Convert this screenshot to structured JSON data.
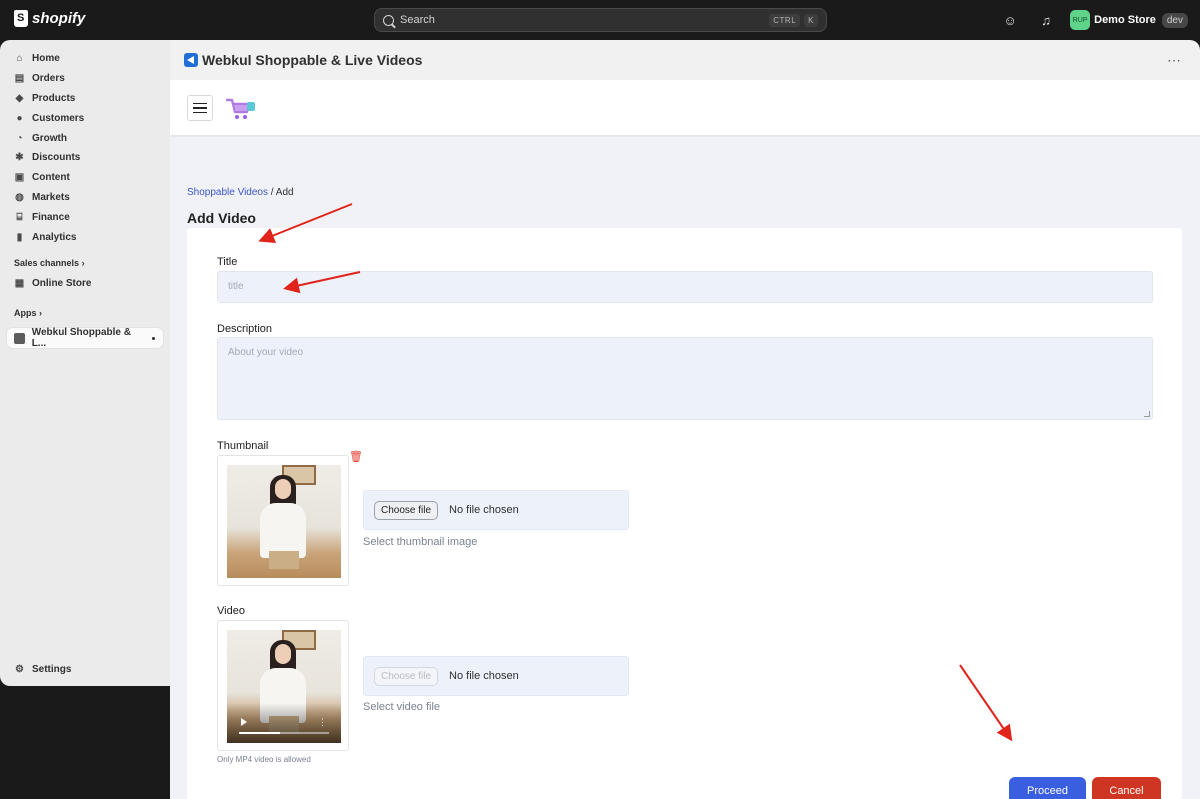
{
  "topbar": {
    "brand": "shopify",
    "search_label": "Search",
    "shortcut_keys": [
      "CTRL",
      "K"
    ],
    "store_avatar": "RUP",
    "store_name": "Demo Store",
    "store_badge": "dev"
  },
  "sidebar": {
    "items": [
      {
        "label": "Home",
        "icon": "home-icon",
        "glyph": "⌂"
      },
      {
        "label": "Orders",
        "icon": "inbox-icon",
        "glyph": "▤"
      },
      {
        "label": "Products",
        "icon": "tag-icon",
        "glyph": "◆"
      },
      {
        "label": "Customers",
        "icon": "person-icon",
        "glyph": "●"
      },
      {
        "label": "Growth",
        "icon": "gauge-icon",
        "glyph": "◔"
      },
      {
        "label": "Discounts",
        "icon": "discount-icon",
        "glyph": "✱"
      },
      {
        "label": "Content",
        "icon": "content-icon",
        "glyph": "▣"
      },
      {
        "label": "Markets",
        "icon": "globe-icon",
        "glyph": "◍"
      },
      {
        "label": "Finance",
        "icon": "bank-icon",
        "glyph": "⌸"
      },
      {
        "label": "Analytics",
        "icon": "bar-chart-icon",
        "glyph": "▮"
      }
    ],
    "sales_channels_label": "Sales channels",
    "online_store_label": "Online Store",
    "apps_label": "Apps",
    "app_item_label": "Webkul Shoppable & L...",
    "settings_label": "Settings"
  },
  "app": {
    "title": "Webkul Shoppable & Live Videos",
    "more": "⋯"
  },
  "breadcrumb": {
    "link": "Shoppable Videos",
    "separator": "/",
    "current": "Add"
  },
  "page_title": "Add Video",
  "form": {
    "title_label": "Title",
    "title_placeholder": "title",
    "description_label": "Description",
    "description_placeholder": "About your video",
    "thumbnail_label": "Thumbnail",
    "thumbnail_choose": "Choose file",
    "thumbnail_nofile": "No file chosen",
    "thumbnail_hint": "Select thumbnail image",
    "video_label": "Video",
    "video_choose": "Choose file",
    "video_nofile": "No file chosen",
    "video_hint": "Select video file",
    "video_note": "Only MP4 video is allowed",
    "video_progress": 0.45
  },
  "actions": {
    "proceed": "Proceed",
    "cancel": "Cancel"
  },
  "colors": {
    "accent": "#3a5ee0",
    "danger": "#cf3523",
    "annotation": "#e0241b"
  }
}
